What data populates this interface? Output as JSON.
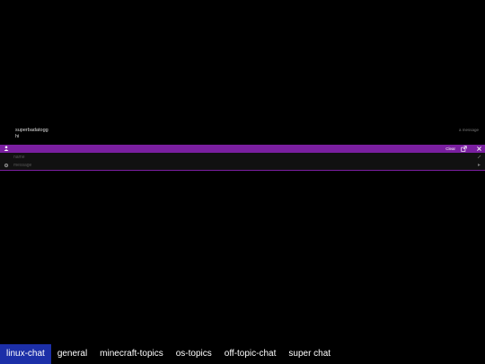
{
  "messages": [
    {
      "author": "superbadatogg",
      "text": "hi",
      "time": "a message"
    }
  ],
  "toolbar": {
    "clear_label": "Clear"
  },
  "inputs": {
    "name_placeholder": "name",
    "message_placeholder": "message"
  },
  "tabs": [
    {
      "label": "linux-chat",
      "active": true
    },
    {
      "label": "general",
      "active": false
    },
    {
      "label": "minecraft-topics",
      "active": false
    },
    {
      "label": "os-topics",
      "active": false
    },
    {
      "label": "off-topic-chat",
      "active": false
    },
    {
      "label": "super chat",
      "active": false
    }
  ],
  "colors": {
    "accent": "#7a1fa0",
    "active_tab": "#1c2fa8",
    "background": "#000000"
  },
  "icons": {
    "user": "user-icon",
    "popout": "popout-icon",
    "close": "close-icon",
    "settings": "settings-icon",
    "send": "send-icon"
  }
}
